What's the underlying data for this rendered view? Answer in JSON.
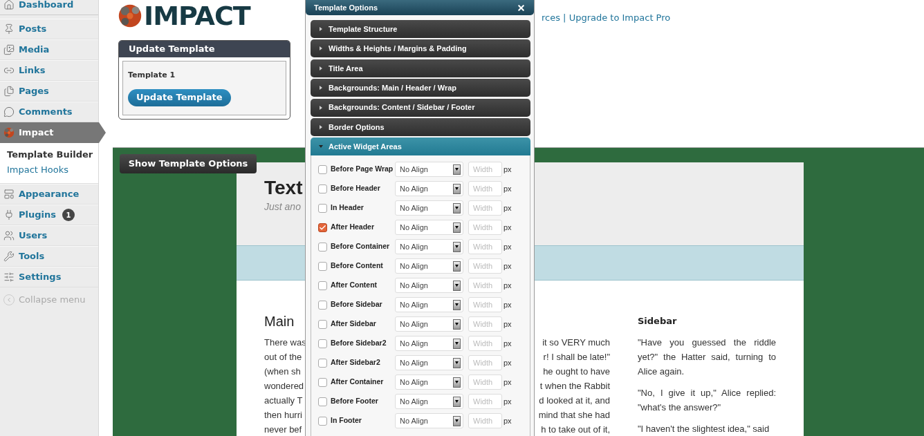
{
  "sidebar": {
    "items": [
      {
        "label": "Dashboard",
        "selected": false
      },
      {
        "label": "Posts",
        "selected": false
      },
      {
        "label": "Media",
        "selected": false
      },
      {
        "label": "Links",
        "selected": false
      },
      {
        "label": "Pages",
        "selected": false
      },
      {
        "label": "Comments",
        "selected": false
      },
      {
        "label": "Impact",
        "selected": true,
        "submenu": [
          {
            "label": "Template Builder",
            "selected": true
          },
          {
            "label": "Impact Hooks",
            "selected": false
          }
        ]
      },
      {
        "label": "Appearance",
        "selected": false
      },
      {
        "label": "Plugins",
        "selected": false,
        "badge": "1"
      },
      {
        "label": "Users",
        "selected": false
      },
      {
        "label": "Tools",
        "selected": false
      },
      {
        "label": "Settings",
        "selected": false
      }
    ],
    "collapse": "Collapse menu"
  },
  "header": {
    "logo_text": "IMPACT",
    "links_prefix": "rces | ",
    "link": "Upgrade to Impact Pro"
  },
  "update_panel": {
    "title": "Update Template",
    "template_name": "Template 1",
    "button": "Update Template"
  },
  "show_options_button": "Show Template Options",
  "preview": {
    "title": "Text",
    "tagline": "Just ano",
    "main_heading": "Main",
    "main_lines": [
      {
        "left": "There was",
        "right": "it so VERY much"
      },
      {
        "left": "out of the",
        "right": "r! I shall be late!\""
      },
      {
        "left": "(when sh",
        "right": "he ought to have"
      },
      {
        "left": "wondered",
        "right": "t when the Rabbit"
      },
      {
        "left": "actually T",
        "right": "d looked at it, and"
      },
      {
        "left": "then hurri",
        "right": "mind that she had"
      },
      {
        "left": "never bef",
        "right": "h to take out of it,"
      }
    ],
    "sidebar_heading": "Sidebar",
    "sidebar_paragraphs": [
      "\"Have you guessed the riddle yet?\" the Hatter said, turning to Alice again.",
      "\"No, I give it up,\" Alice replied: \"what's the answer?\"",
      "\"I haven't the slightest idea,\" said"
    ]
  },
  "modal": {
    "title": "Template Options",
    "sections": [
      {
        "label": "Template Structure",
        "expanded": false
      },
      {
        "label": "Widths & Heights / Margins & Padding",
        "expanded": false
      },
      {
        "label": "Title Area",
        "expanded": false
      },
      {
        "label": "Backgrounds: Main / Header / Wrap",
        "expanded": false
      },
      {
        "label": "Backgrounds: Content / Sidebar / Footer",
        "expanded": false
      },
      {
        "label": "Border Options",
        "expanded": false
      },
      {
        "label": "Active Widget Areas",
        "expanded": true
      }
    ],
    "widget_areas": [
      {
        "label": "Before Page Wrap",
        "checked": false,
        "align": "No Align",
        "width_placeholder": "Width",
        "unit": "px"
      },
      {
        "label": "Before Header",
        "checked": false,
        "align": "No Align",
        "width_placeholder": "Width",
        "unit": "px"
      },
      {
        "label": "In Header",
        "checked": false,
        "align": "No Align",
        "width_placeholder": "Width",
        "unit": "px"
      },
      {
        "label": "After Header",
        "checked": true,
        "align": "No Align",
        "width_placeholder": "Width",
        "unit": "px"
      },
      {
        "label": "Before Container",
        "checked": false,
        "align": "No Align",
        "width_placeholder": "Width",
        "unit": "px"
      },
      {
        "label": "Before Content",
        "checked": false,
        "align": "No Align",
        "width_placeholder": "Width",
        "unit": "px"
      },
      {
        "label": "After Content",
        "checked": false,
        "align": "No Align",
        "width_placeholder": "Width",
        "unit": "px"
      },
      {
        "label": "Before Sidebar",
        "checked": false,
        "align": "No Align",
        "width_placeholder": "Width",
        "unit": "px"
      },
      {
        "label": "After Sidebar",
        "checked": false,
        "align": "No Align",
        "width_placeholder": "Width",
        "unit": "px"
      },
      {
        "label": "Before Sidebar2",
        "checked": false,
        "align": "No Align",
        "width_placeholder": "Width",
        "unit": "px"
      },
      {
        "label": "After Sidebar2",
        "checked": false,
        "align": "No Align",
        "width_placeholder": "Width",
        "unit": "px"
      },
      {
        "label": "After Container",
        "checked": false,
        "align": "No Align",
        "width_placeholder": "Width",
        "unit": "px"
      },
      {
        "label": "Before Footer",
        "checked": false,
        "align": "No Align",
        "width_placeholder": "Width",
        "unit": "px"
      },
      {
        "label": "In Footer",
        "checked": false,
        "align": "No Align",
        "width_placeholder": "Width",
        "unit": "px"
      }
    ]
  }
}
